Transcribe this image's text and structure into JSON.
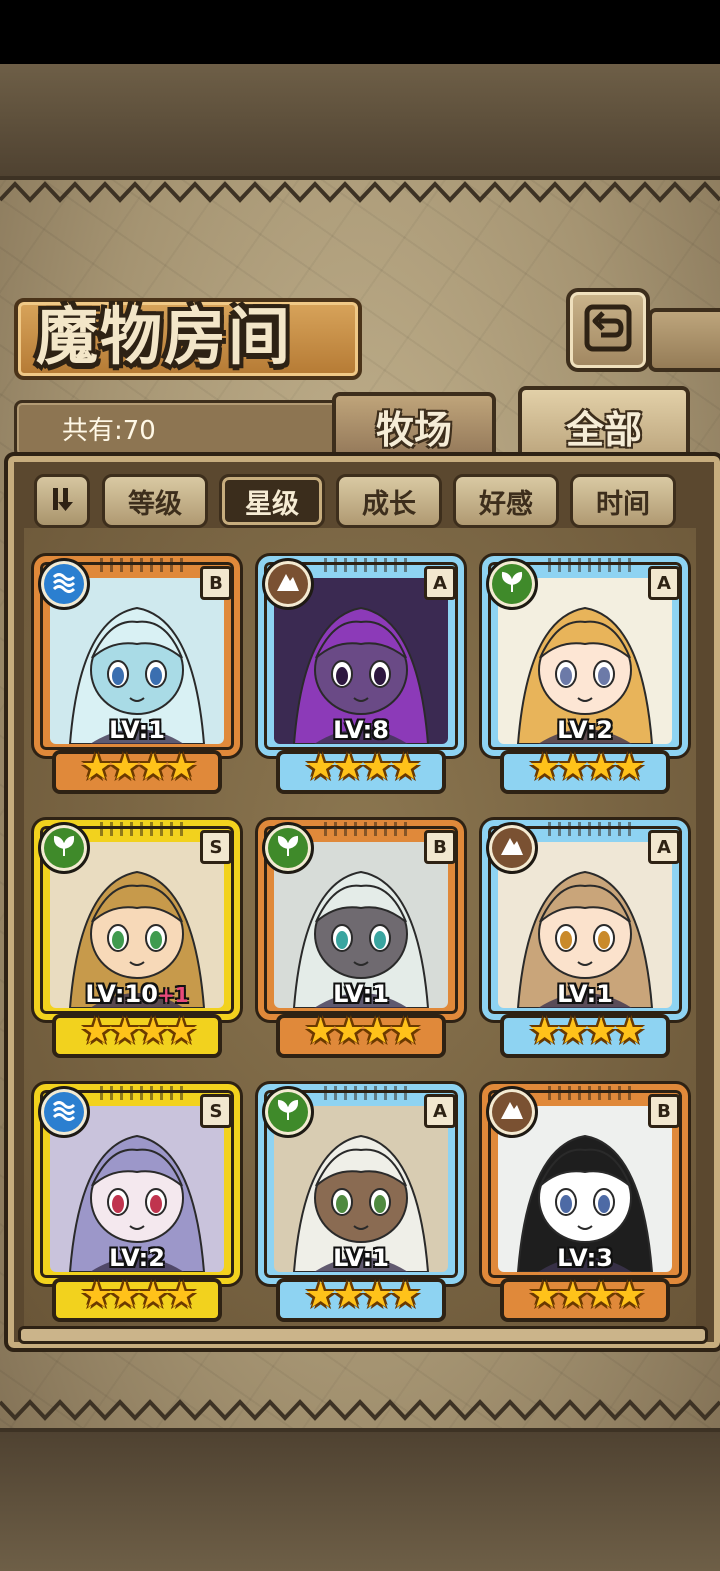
{
  "header": {
    "title": "魔物房间",
    "back_icon": "return-arrow-icon"
  },
  "summary": {
    "count_label": "共有:70"
  },
  "tabs": [
    {
      "label": "牧场",
      "active": false
    },
    {
      "label": "全部",
      "active": true
    }
  ],
  "filters": {
    "toggle_icon": "sort-toggle-icon",
    "buttons": [
      {
        "label": "等级",
        "active": false
      },
      {
        "label": "星级",
        "active": true
      },
      {
        "label": "成长",
        "active": false
      },
      {
        "label": "好感",
        "active": false
      },
      {
        "label": "时间",
        "active": false
      }
    ]
  },
  "cards": [
    {
      "level": "LV:1",
      "bonus": "",
      "rank": "B",
      "element": "water-icon",
      "frame": "bronze",
      "stars": "★★★★"
    },
    {
      "level": "LV:8",
      "bonus": "",
      "rank": "A",
      "element": "earth-icon",
      "frame": "silver",
      "stars": "★★★★"
    },
    {
      "level": "LV:2",
      "bonus": "",
      "rank": "A",
      "element": "leaf-icon",
      "frame": "silver",
      "stars": "★★★★"
    },
    {
      "level": "LV:10",
      "bonus": "+1",
      "rank": "S",
      "element": "leaf-icon",
      "frame": "gold",
      "stars": "★★★★"
    },
    {
      "level": "LV:1",
      "bonus": "",
      "rank": "B",
      "element": "leaf-icon",
      "frame": "bronze",
      "stars": "★★★★"
    },
    {
      "level": "LV:1",
      "bonus": "",
      "rank": "A",
      "element": "earth-icon",
      "frame": "silver",
      "stars": "★★★★"
    },
    {
      "level": "LV:2",
      "bonus": "",
      "rank": "S",
      "element": "water-icon",
      "frame": "gold",
      "stars": "★★★★"
    },
    {
      "level": "LV:1",
      "bonus": "",
      "rank": "A",
      "element": "leaf-icon",
      "frame": "silver",
      "stars": "★★★★"
    },
    {
      "level": "LV:3",
      "bonus": "",
      "rank": "B",
      "element": "earth-icon",
      "frame": "bronze",
      "stars": "★★★★"
    }
  ],
  "colors": {
    "bronze": "#e0893a",
    "silver": "#8ed3f2",
    "gold": "#f2d21e",
    "water": "#2b7fd0",
    "leaf": "#3f8a2a",
    "earth": "#7a5132"
  }
}
